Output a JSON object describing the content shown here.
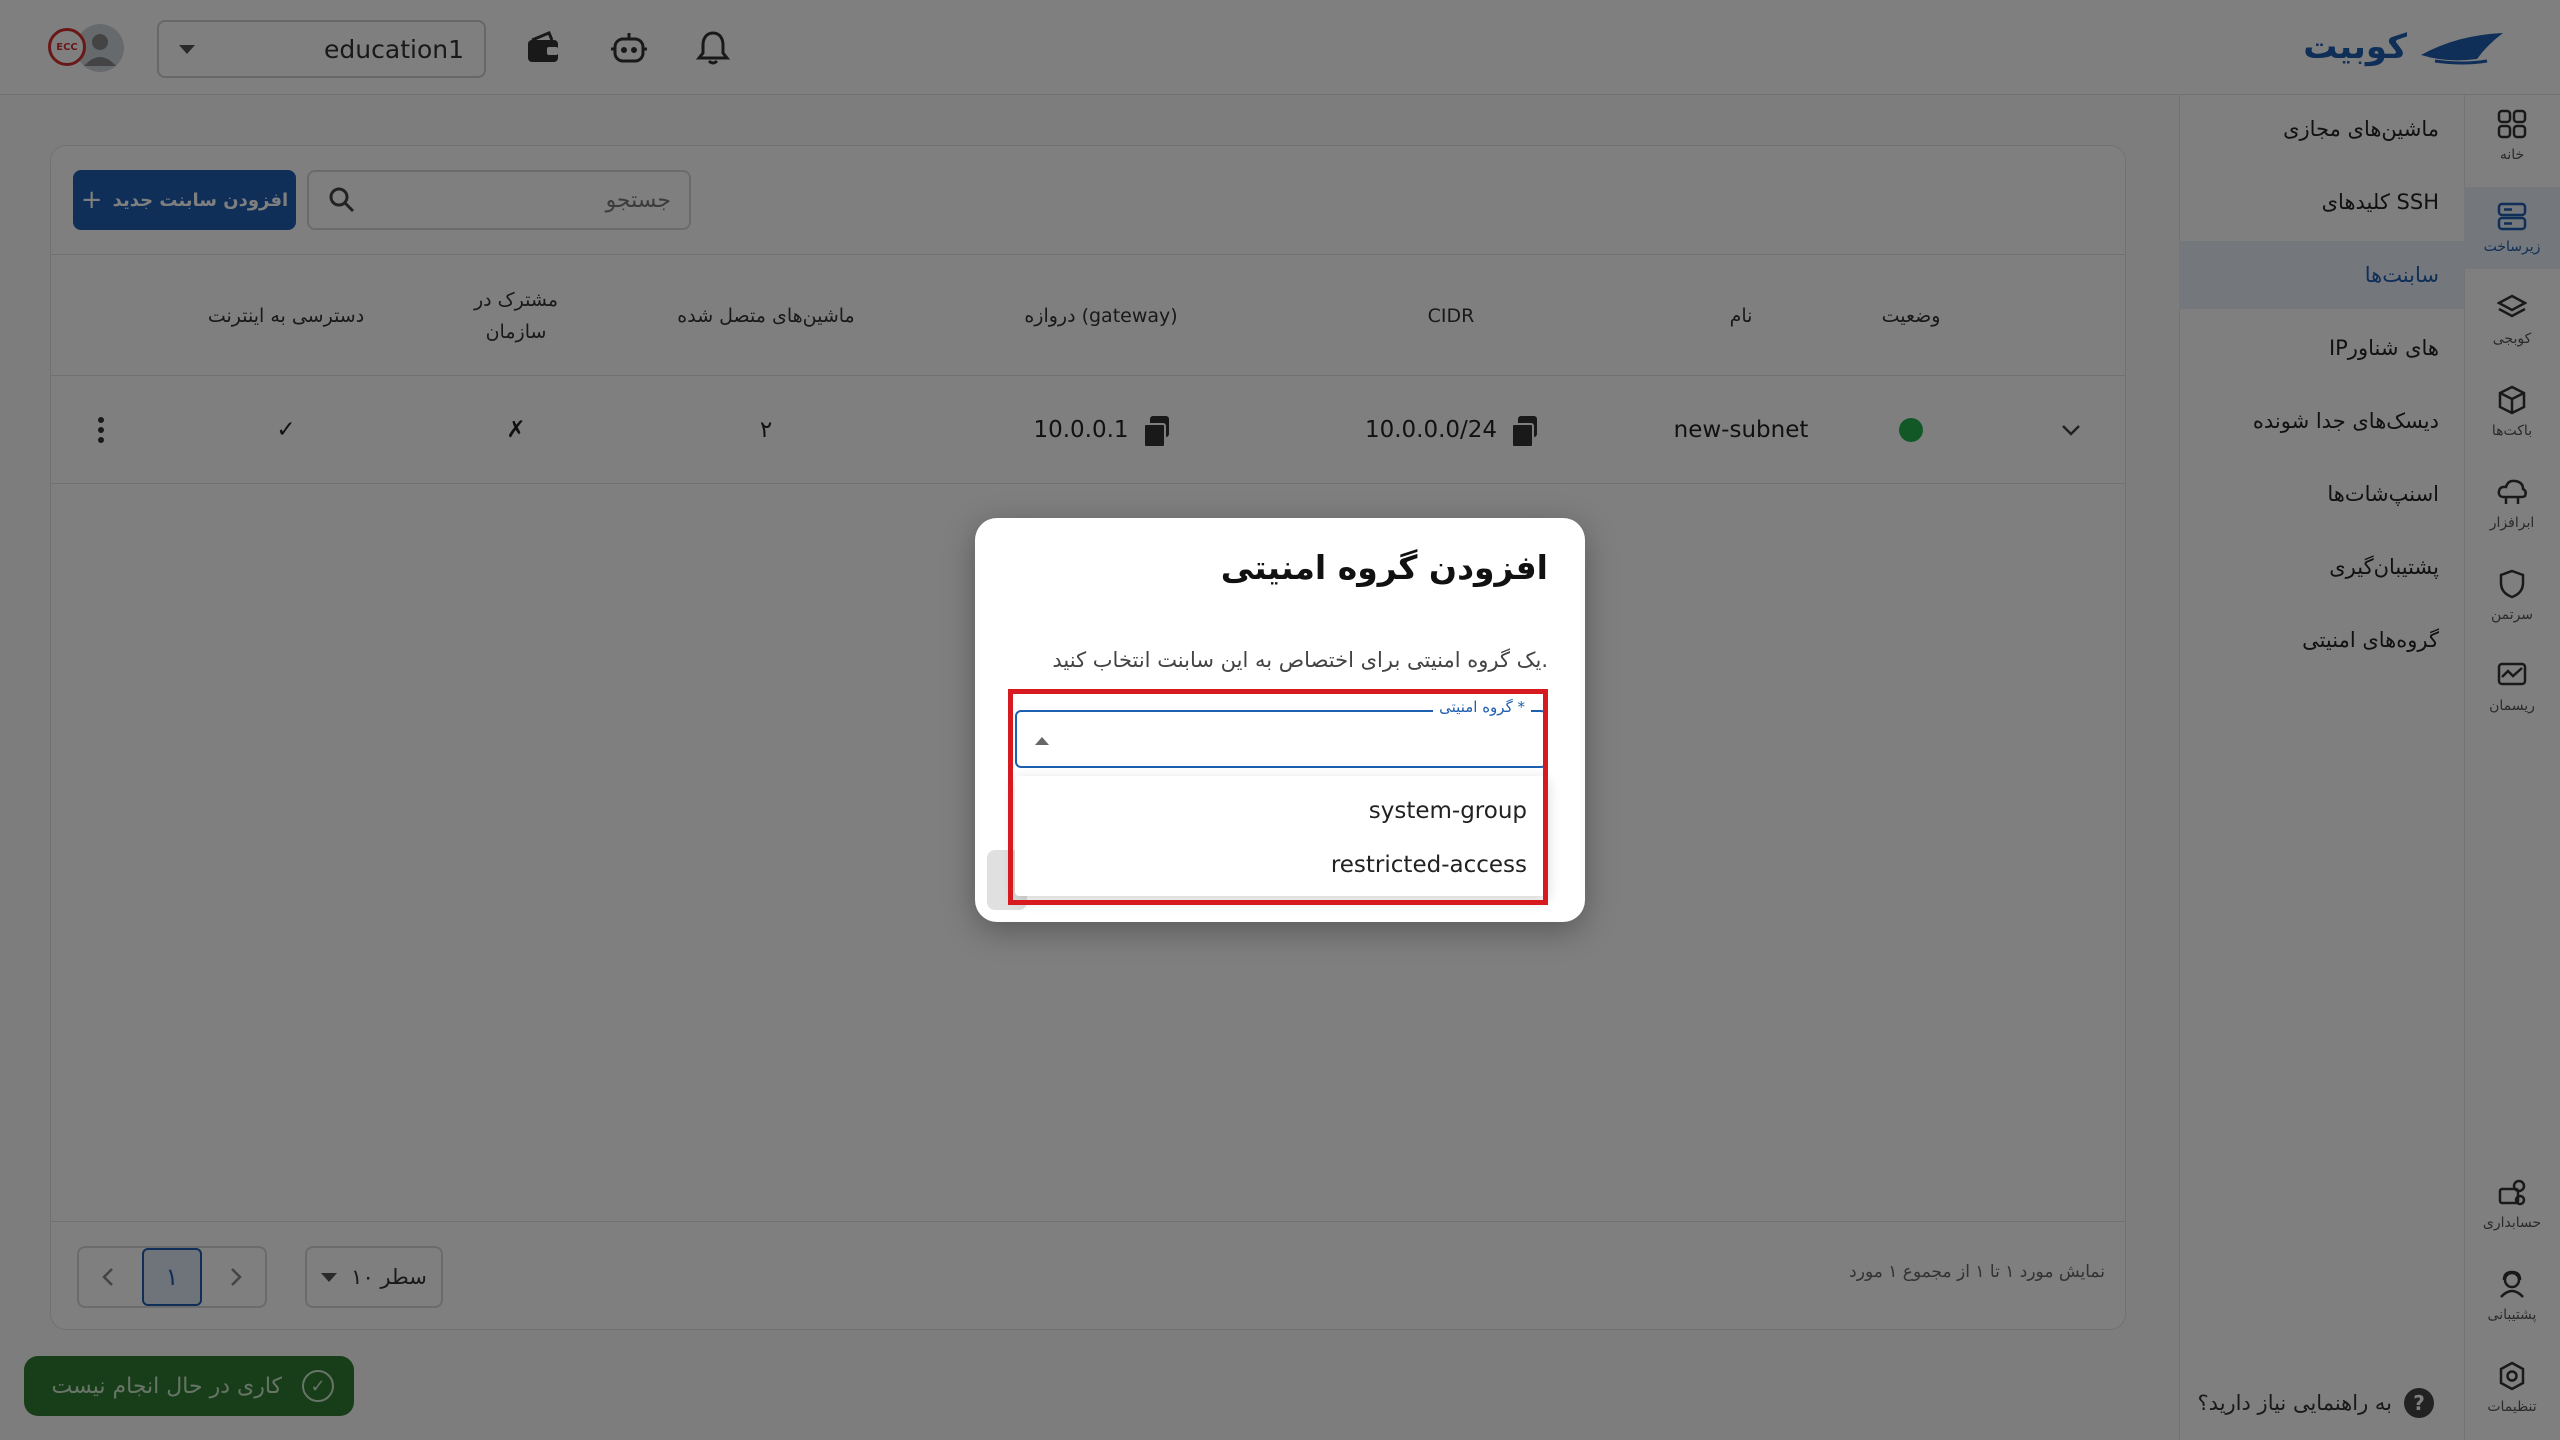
{
  "topbar": {
    "brand": "کوبیت",
    "project": "education1",
    "avatar_badge": "ECC"
  },
  "rail": [
    {
      "label": "خانه",
      "icon": "grid-icon",
      "active": false
    },
    {
      "label": "زیرساخت",
      "icon": "server-icon",
      "active": true
    },
    {
      "label": "کوبجی",
      "icon": "layers-icon",
      "active": false
    },
    {
      "label": "باکت‌ها",
      "icon": "cube-icon",
      "active": false
    },
    {
      "label": "ابرافزار",
      "icon": "cloud-icon",
      "active": false
    },
    {
      "label": "سرتمن",
      "icon": "shield-icon",
      "active": false
    },
    {
      "label": "ریسمان",
      "icon": "monitor-icon",
      "active": false
    },
    {
      "label": "حسابداری",
      "icon": "accounting-icon",
      "active": false
    },
    {
      "label": "پشتیبانی",
      "icon": "support-icon",
      "active": false
    },
    {
      "label": "تنظیمات",
      "icon": "settings-icon",
      "active": false
    }
  ],
  "sidebar": {
    "items": [
      {
        "label": "ماشین‌های مجازی",
        "active": false
      },
      {
        "label": "کلیدهای SSH",
        "active": false
      },
      {
        "label": "سابنت‌ها",
        "active": true
      },
      {
        "label": "IPهای شناور",
        "active": false
      },
      {
        "label": "دیسک‌های جدا شونده",
        "active": false
      },
      {
        "label": "اسنپ‌شات‌ها",
        "active": false
      },
      {
        "label": "پشتیبان‌گیری",
        "active": false
      },
      {
        "label": "گروه‌های امنیتی",
        "active": false
      }
    ],
    "help": "به راهنمایی نیاز دارید؟",
    "help_symbol": "?"
  },
  "toolbar": {
    "add_label": "افزودن سابنت جدید",
    "search_placeholder": "جستجو"
  },
  "table": {
    "headers": {
      "status": "وضعیت",
      "name": "نام",
      "cidr": "CIDR",
      "gateway": "دروازه (gateway)",
      "machines": "ماشین‌های متصل شده",
      "shared_line1": "مشترک در",
      "shared_line2": "سازمان",
      "internet": "دسترسی به اینترنت"
    },
    "rows": [
      {
        "name": "new-subnet",
        "cidr": "10.0.0.0/24",
        "gateway": "10.0.0.1",
        "machines": "۲",
        "shared": "✗",
        "internet": "✓"
      }
    ]
  },
  "footer": {
    "records": "نمایش مورد ۱ تا ۱ از مجموع ۱ مورد",
    "rows_per_page": "۱۰ سطر",
    "current_page": "۱"
  },
  "toast": {
    "text": "کاری در حال انجام نیست"
  },
  "dialog": {
    "title": "افزودن گروه امنیتی",
    "description": "یک گروه امنیتی برای اختصاص به این سابنت انتخاب کنید.",
    "field_label": "گروه امنیتی *",
    "options": [
      "system-group",
      "restricted-access"
    ]
  },
  "colors": {
    "accent": "#1f5fb0",
    "status_ok": "#22b14c",
    "toast": "#2e7d32",
    "highlight": "#d71920"
  }
}
